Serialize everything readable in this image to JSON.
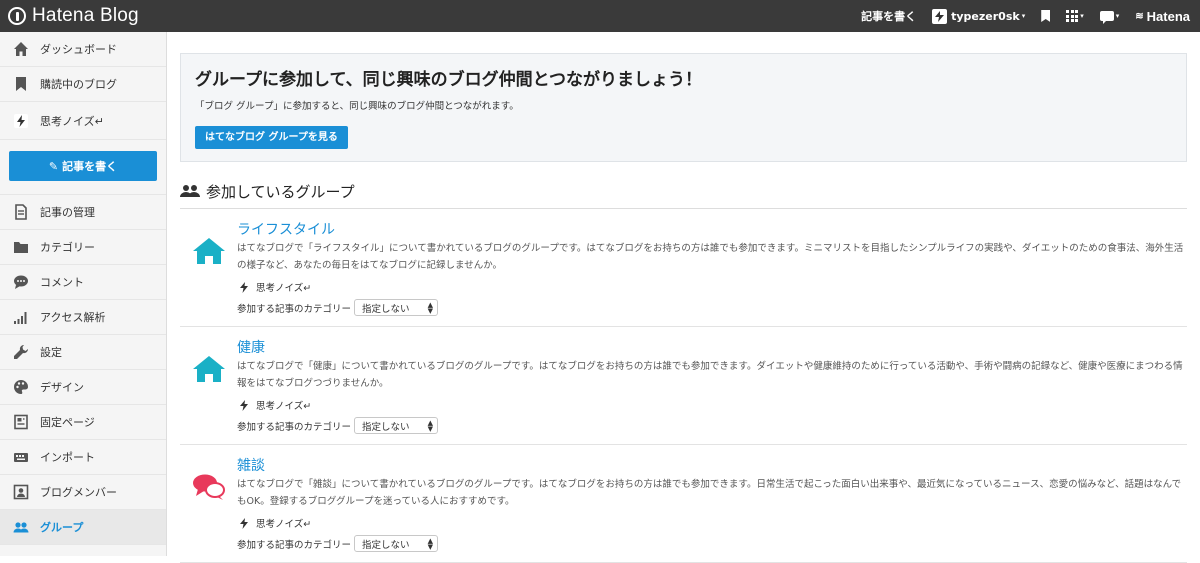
{
  "app": {
    "logo": "Hatena Blog"
  },
  "topbar": {
    "write_label": "記事を書く",
    "user": "typezer0sk",
    "brand": "Hatena"
  },
  "sidebar": {
    "items": [
      {
        "label": "ダッシュボード",
        "icon": "home-icon"
      },
      {
        "label": "購読中のブログ",
        "icon": "bookmark-icon"
      },
      {
        "label": "思考ノイズ↵",
        "icon": "bolt-icon"
      },
      {
        "label": "記事の管理",
        "icon": "document-icon"
      },
      {
        "label": "カテゴリー",
        "icon": "folder-icon"
      },
      {
        "label": "コメント",
        "icon": "comment-icon"
      },
      {
        "label": "アクセス解析",
        "icon": "signal-icon"
      },
      {
        "label": "設定",
        "icon": "wrench-icon"
      },
      {
        "label": "デザイン",
        "icon": "palette-icon"
      },
      {
        "label": "固定ページ",
        "icon": "page-icon"
      },
      {
        "label": "インポート",
        "icon": "import-icon"
      },
      {
        "label": "ブログメンバー",
        "icon": "member-icon"
      },
      {
        "label": "グループ",
        "icon": "group-icon"
      }
    ],
    "write_button": "記事を書く"
  },
  "promo": {
    "title": "グループに参加して、同じ興味のブログ仲間とつながりましょう！",
    "desc": "「ブログ グループ」に参加すると、同じ興味のブログ仲間とつながれます。",
    "button": "はてなブログ グループを見る"
  },
  "section": {
    "title": "参加しているグループ"
  },
  "groups": [
    {
      "name": "ライフスタイル",
      "desc": "はてなブログで「ライフスタイル」について書かれているブログのグループです。はてなブログをお持ちの方は誰でも参加できます。ミニマリストを目指したシンプルライフの実践や、ダイエットのための食事法、海外生活の様子など、あなたの毎日をはてなブログに記録しませんか。",
      "blog": "思考ノイズ↵",
      "category_label": "参加する記事のカテゴリー",
      "category_value": "指定しない",
      "icon": "house-icon",
      "color": "#1ab0c6"
    },
    {
      "name": "健康",
      "desc": "はてなブログで「健康」について書かれているブログのグループです。はてなブログをお持ちの方は誰でも参加できます。ダイエットや健康維持のために行っている活動や、手術や闘病の記録など、健康や医療にまつわる情報をはてなブログつづりませんか。",
      "blog": "思考ノイズ↵",
      "category_label": "参加する記事のカテゴリー",
      "category_value": "指定しない",
      "icon": "house-icon",
      "color": "#1ab0c6"
    },
    {
      "name": "雑談",
      "desc": "はてなブログで「雑談」について書かれているブログのグループです。はてなブログをお持ちの方は誰でも参加できます。日常生活で起こった面白い出来事や、最近気になっているニュース、恋愛の悩みなど、話題はなんでもOK。登録するブロググループを迷っている人におすすめです。",
      "blog": "思考ノイズ↵",
      "category_label": "参加する記事のカテゴリー",
      "category_value": "指定しない",
      "icon": "chat-bubbles-icon",
      "color": "#e8395b"
    }
  ]
}
